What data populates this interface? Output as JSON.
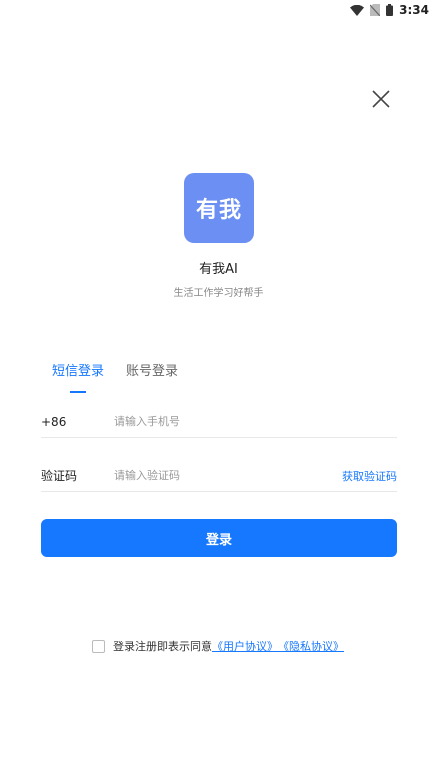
{
  "status_bar": {
    "time": "3:34",
    "icons": [
      "wifi-icon",
      "no-sim-icon",
      "battery-icon"
    ]
  },
  "header": {
    "close_icon": "close-icon"
  },
  "app": {
    "logo_text": "有我",
    "name": "有我AI",
    "slogan": "生活工作学习好帮手",
    "logo_color": "#6b8ff3"
  },
  "tabs": [
    {
      "label": "短信登录",
      "active": true
    },
    {
      "label": "账号登录",
      "active": false
    }
  ],
  "form": {
    "phone": {
      "prefix": "+86",
      "placeholder": "请输入手机号",
      "value": ""
    },
    "code": {
      "label": "验证码",
      "placeholder": "请输入验证码",
      "value": "",
      "get_code_label": "获取验证码"
    }
  },
  "login_button": {
    "label": "登录",
    "color": "#1677ff"
  },
  "agreement": {
    "checked": false,
    "text": "登录注册即表示同意",
    "user_agreement": "《用户协议》",
    "privacy_policy": "《隐私协议》"
  }
}
